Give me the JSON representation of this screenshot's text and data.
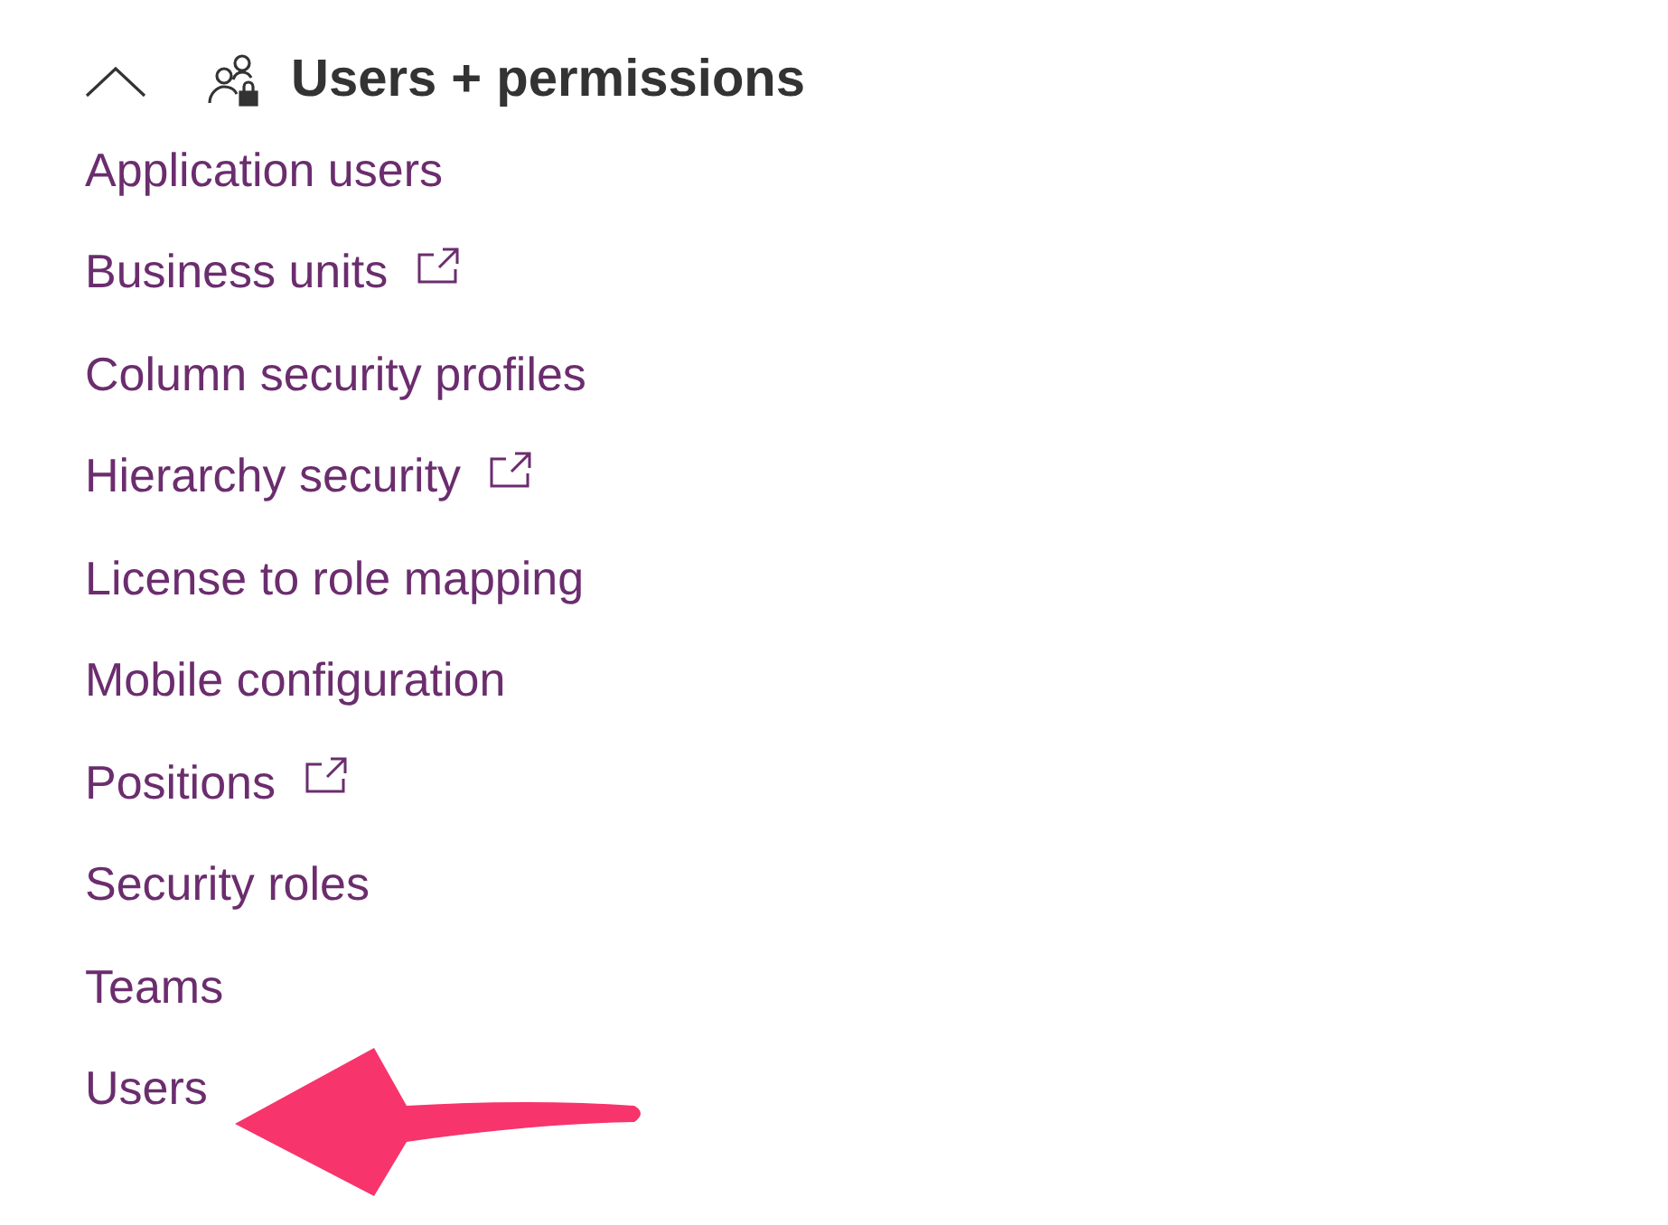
{
  "section": {
    "title": "Users + permissions",
    "expanded": true,
    "items": [
      {
        "label": "Application users",
        "external": false
      },
      {
        "label": "Business units",
        "external": true
      },
      {
        "label": "Column security profiles",
        "external": false
      },
      {
        "label": "Hierarchy security",
        "external": true
      },
      {
        "label": "License to role mapping",
        "external": false
      },
      {
        "label": "Mobile configuration",
        "external": false
      },
      {
        "label": "Positions",
        "external": true
      },
      {
        "label": "Security roles",
        "external": false
      },
      {
        "label": "Teams",
        "external": false
      },
      {
        "label": "Users",
        "external": false
      }
    ]
  }
}
